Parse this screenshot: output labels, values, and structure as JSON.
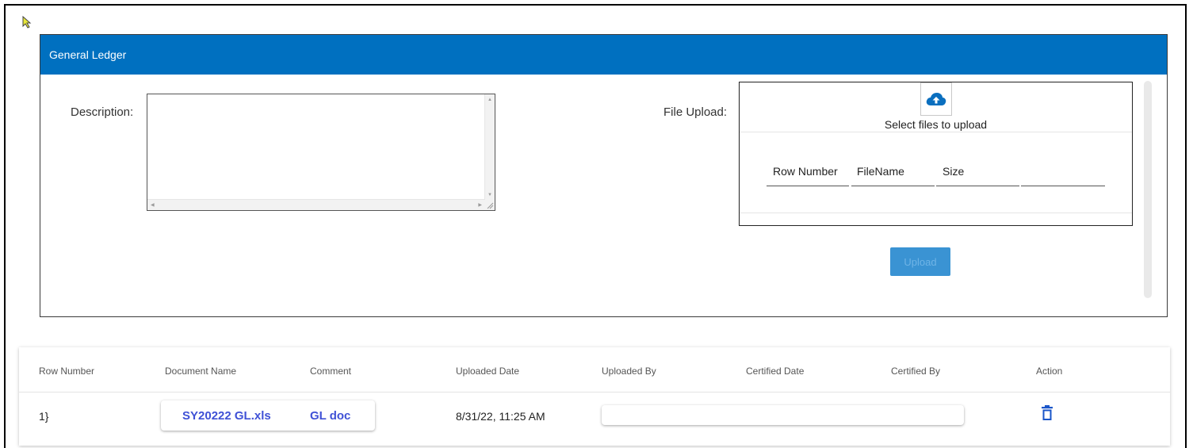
{
  "panel": {
    "title": "General Ledger",
    "description_label": "Description:",
    "description_value": "",
    "file_upload_label": "File Upload:",
    "select_files_text": "Select files to upload",
    "file_table_headers": [
      "Row Number",
      "FileName",
      "Size"
    ],
    "upload_button": "Upload"
  },
  "table": {
    "headers": [
      "Row Number",
      "Document Name",
      "Comment",
      "Uploaded Date",
      "Uploaded By",
      "Certified Date",
      "Certified By",
      "Action"
    ],
    "rows": [
      {
        "row_number": "1}",
        "document_name": "SY20222 GL.xls",
        "comment": "GL doc",
        "uploaded_date": "8/31/22, 11:25 AM",
        "uploaded_by": "",
        "certified_date": "",
        "certified_by": ""
      }
    ]
  },
  "colors": {
    "header_blue": "#0070c0",
    "upload_button": "#3a93d3",
    "link": "#3f51d6"
  },
  "icons": {
    "upload": "cloud-upload-icon",
    "delete": "trash-icon",
    "cursor": "mouse-pointer-icon"
  }
}
